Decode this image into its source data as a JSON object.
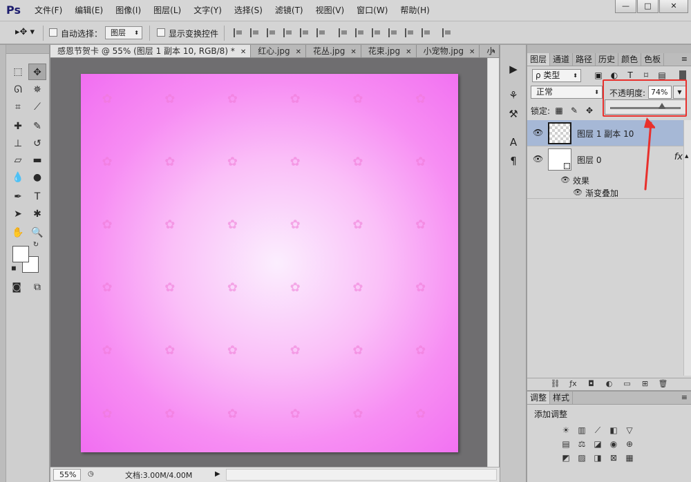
{
  "app": {
    "logo": "Ps",
    "menu": [
      "文件(F)",
      "编辑(E)",
      "图像(I)",
      "图层(L)",
      "文字(Y)",
      "选择(S)",
      "滤镜(T)",
      "视图(V)",
      "窗口(W)",
      "帮助(H)"
    ],
    "window_buttons": [
      "—",
      "□",
      "✕"
    ]
  },
  "options": {
    "auto_select_label": "自动选择：",
    "auto_select_value": "图层",
    "show_transform_label": "显示变换控件"
  },
  "doc_tabs": [
    {
      "label": "感恩节贺卡 @ 55% (图层 1 副本 10, RGB/8) *",
      "active": true
    },
    {
      "label": "红心.jpg",
      "active": false
    },
    {
      "label": "花丛.jpg",
      "active": false
    },
    {
      "label": "花束.jpg",
      "active": false
    },
    {
      "label": "小宠物.jpg",
      "active": false
    },
    {
      "label": "小",
      "active": false
    }
  ],
  "doc_tabs_more": "»",
  "status": {
    "zoom": "55%",
    "doc_info": "文档:3.00M/4.00M"
  },
  "layers_panel": {
    "tabs": [
      "图层",
      "通道",
      "路径",
      "历史",
      "颜色",
      "色板"
    ],
    "filter_value": "ρ 类型",
    "blend_mode": "正常",
    "opacity_label": "不透明度:",
    "opacity_value": "74%",
    "opacity_fraction": 0.74,
    "lock_label": "锁定:",
    "layers": [
      {
        "name": "图层 1 副本 10",
        "selected": true
      },
      {
        "name": "图层 0",
        "selected": false,
        "fx": "fx"
      }
    ],
    "effects_label": "效果",
    "effect_item": "渐变叠加"
  },
  "adjust_panel": {
    "tabs": [
      "调整",
      "样式"
    ],
    "title": "添加调整"
  },
  "colors": {
    "highlight": "#e8302c",
    "selected_layer": "#a6b8d6",
    "canvas_center": "#fbeefe",
    "canvas_edge": "#f16ef1"
  }
}
